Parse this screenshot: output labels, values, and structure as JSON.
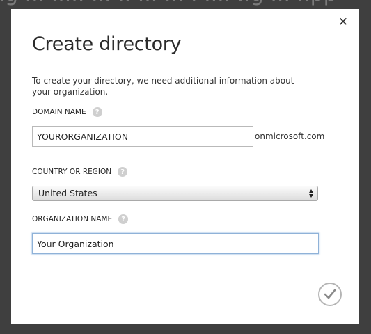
{
  "backdrop": {
    "text": "ng ... ..... ... .. ... ... . .... ..g ... ..pp"
  },
  "dialog": {
    "close_symbol": "✕",
    "title": "Create directory",
    "intro": "To create your directory, we need additional information about your organization.",
    "help_symbol": "?",
    "domain": {
      "label": "DOMAIN NAME",
      "value": "YOURORGANIZATION",
      "suffix": "onmicrosoft.com"
    },
    "country": {
      "label": "COUNTRY OR REGION",
      "value": "United States"
    },
    "organization": {
      "label": "ORGANIZATION NAME",
      "value": "Your Organization"
    },
    "icons": {
      "close": "close-icon",
      "help": "help-icon",
      "confirm": "checkmark-icon",
      "select_arrows": "select-arrows-icon"
    },
    "colors": {
      "overlay": "#3f3f3f",
      "dialog_bg": "#ffffff",
      "focus_border": "#8fb2d8",
      "help_icon_bg": "#cfcfcf",
      "confirm_ring": "#b5b5b5"
    }
  }
}
